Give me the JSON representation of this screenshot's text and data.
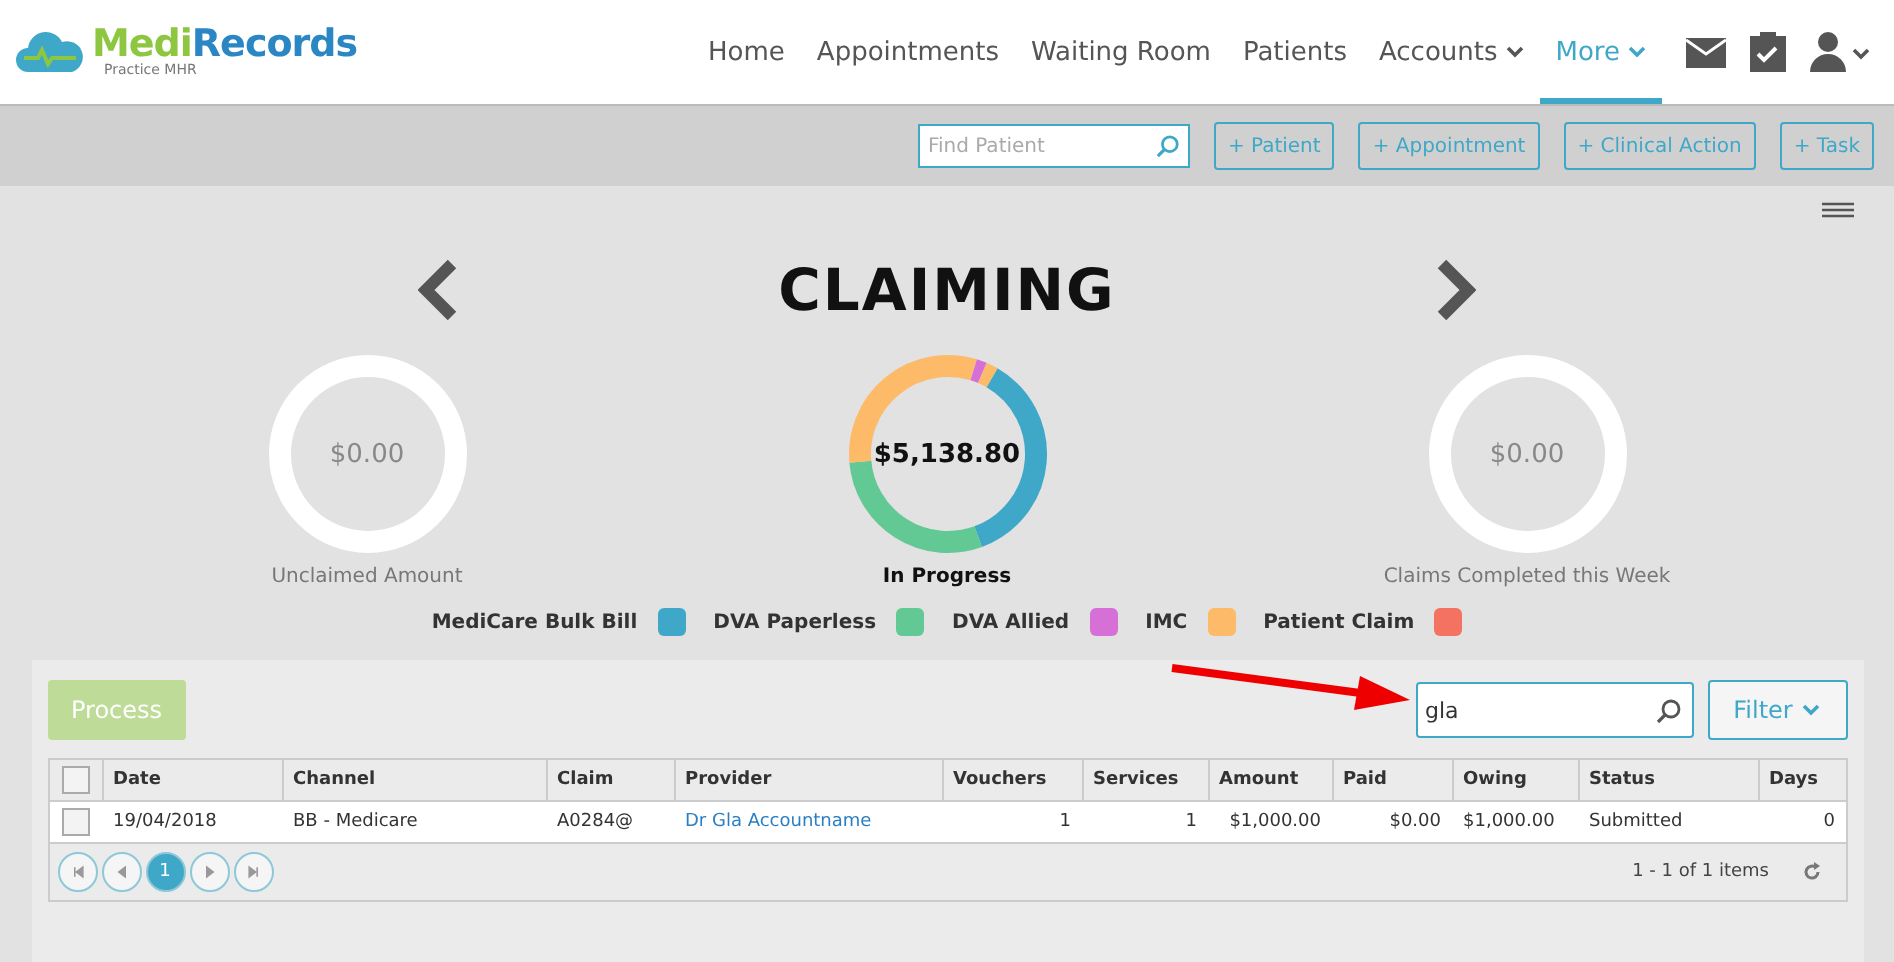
{
  "brand": {
    "name_part1": "Medi",
    "name_part2": "Records",
    "subtitle": "Practice MHR"
  },
  "nav": [
    {
      "label": "Home",
      "selected": false,
      "dropdown": false
    },
    {
      "label": "Appointments",
      "selected": false,
      "dropdown": false
    },
    {
      "label": "Waiting Room",
      "selected": false,
      "dropdown": false
    },
    {
      "label": "Patients",
      "selected": false,
      "dropdown": false
    },
    {
      "label": "Accounts",
      "selected": false,
      "dropdown": true
    },
    {
      "label": "More",
      "selected": true,
      "dropdown": true
    }
  ],
  "toolbar": {
    "search_placeholder": "Find Patient",
    "buttons": [
      "+ Patient",
      "+ Appointment",
      "+ Clinical Action",
      "+ Task"
    ]
  },
  "title": "CLAIMING",
  "summaries": [
    {
      "kind": "empty",
      "value": "$0.00",
      "label": "Unclaimed Amount"
    },
    {
      "kind": "active",
      "value": "$5,138.80",
      "label": "In Progress"
    },
    {
      "kind": "empty",
      "value": "$0.00",
      "label": "Claims Completed this Week"
    }
  ],
  "legend": [
    {
      "label": "MediCare Bulk Bill",
      "color": "#3fa8c8"
    },
    {
      "label": "DVA Paperless",
      "color": "#62c995"
    },
    {
      "label": "DVA Allied",
      "color": "#d66fd6"
    },
    {
      "label": "IMC",
      "color": "#fdbb69"
    },
    {
      "label": "Patient Claim",
      "color": "#f47262"
    }
  ],
  "process_button": "Process",
  "search": {
    "value": "gla"
  },
  "filter_button": "Filter",
  "table": {
    "select_all_checked": false,
    "columns": [
      "Date",
      "Channel",
      "Claim",
      "Provider",
      "Vouchers",
      "Services",
      "Amount",
      "Paid",
      "Owing",
      "Status",
      "Days"
    ],
    "rows": [
      {
        "checked": false,
        "cells": [
          "19/04/2018",
          "BB - Medicare",
          "A0284@",
          "Dr Gla Accountname",
          "1",
          "1",
          "$1,000.00",
          "$0.00",
          "$1,000.00",
          "Submitted",
          "0"
        ]
      }
    ]
  },
  "pager": {
    "pages": [
      {
        "label": "1",
        "selected": true
      }
    ],
    "summary": "1 - 1 of 1 items"
  }
}
